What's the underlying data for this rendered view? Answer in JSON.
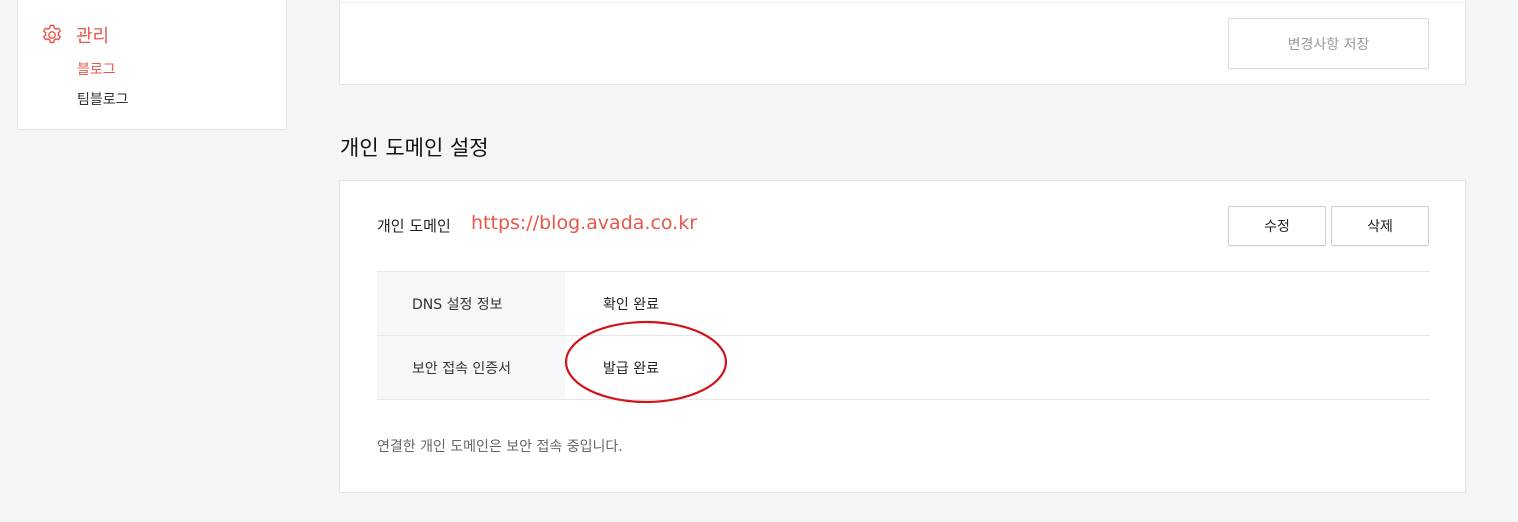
{
  "sidebar": {
    "section_label": "관리",
    "section_icon": "gear-icon",
    "items": [
      {
        "label": "블로그",
        "active": true
      },
      {
        "label": "팀블로그",
        "active": false
      }
    ]
  },
  "top_card": {
    "save_label": "변경사항 저장"
  },
  "domain_section": {
    "title": "개인 도메인 설정",
    "label": "개인 도메인",
    "url": "https://blog.avada.co.kr",
    "edit_label": "수정",
    "delete_label": "삭제",
    "rows": [
      {
        "key": "DNS 설정 정보",
        "value": "확인 완료"
      },
      {
        "key": "보안 접속 인증서",
        "value": "발급 완료"
      }
    ],
    "note": "연결한 개인 도메인은 보안 접속 중입니다."
  },
  "colors": {
    "accent": "#e8574a",
    "annotation": "#d0141b",
    "background": "#f4f5f7"
  }
}
